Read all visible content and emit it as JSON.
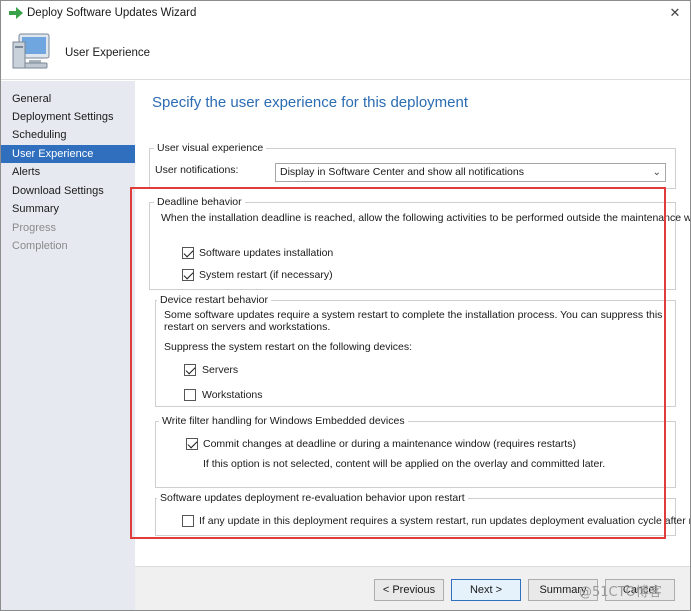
{
  "window": {
    "title": "Deploy Software Updates Wizard",
    "close_glyph": "✕",
    "header_title": "User Experience"
  },
  "nav": {
    "items": [
      {
        "label": "General",
        "state": "normal"
      },
      {
        "label": "Deployment Settings",
        "state": "normal"
      },
      {
        "label": "Scheduling",
        "state": "normal"
      },
      {
        "label": "User Experience",
        "state": "active"
      },
      {
        "label": "Alerts",
        "state": "normal"
      },
      {
        "label": "Download Settings",
        "state": "normal"
      },
      {
        "label": "Summary",
        "state": "normal"
      },
      {
        "label": "Progress",
        "state": "disabled"
      },
      {
        "label": "Completion",
        "state": "disabled"
      }
    ]
  },
  "main": {
    "title": "Specify the user experience for this deployment",
    "visual": {
      "group_label": "User visual experience",
      "notifications_label": "User notifications:",
      "notifications_value": "Display in Software Center and show all notifications"
    },
    "deadline": {
      "group_label": "Deadline behavior",
      "description": "When the installation deadline is reached, allow the following activities to be performed outside the maintenance window:",
      "software_updates_label": "Software updates installation",
      "software_updates_checked": true,
      "system_restart_label": "System restart (if necessary)",
      "system_restart_checked": true
    },
    "restart": {
      "group_label": "Device restart behavior",
      "description": "Some software updates require a system restart to complete the installation process. You can suppress this restart on servers and workstations.",
      "suppress_label": "Suppress the system restart on the following devices:",
      "servers_label": "Servers",
      "servers_checked": true,
      "workstations_label": "Workstations",
      "workstations_checked": false
    },
    "write_filter": {
      "group_label": "Write filter handling for Windows Embedded devices",
      "commit_label": "Commit changes at deadline or during a maintenance window (requires restarts)",
      "commit_checked": true,
      "note": "If this option is not selected, content will be applied on the overlay and committed later."
    },
    "reevaluation": {
      "group_label": "Software updates deployment re-evaluation behavior upon restart",
      "option_label": "If any update in this deployment requires a system restart, run updates deployment evaluation cycle after restart",
      "option_checked": false
    }
  },
  "footer": {
    "previous_label": "< Previous",
    "next_label": "Next >",
    "summary_label": "Summary",
    "cancel_label": "Cancel"
  },
  "watermark": "@51CTO博客",
  "colors": {
    "accent": "#2f6fbe",
    "title_blue": "#2b6cb3",
    "highlight_border": "#e03c3c",
    "nav_background": "#e6eaf0"
  }
}
